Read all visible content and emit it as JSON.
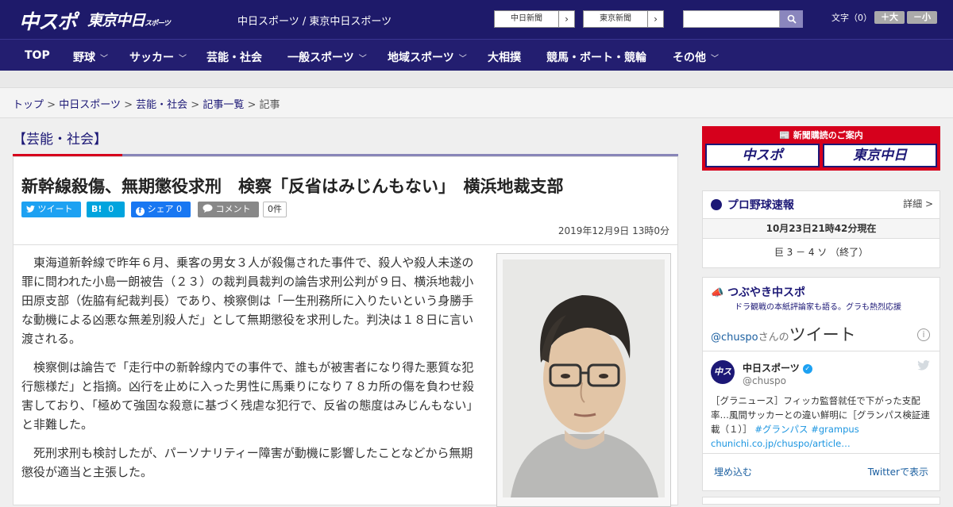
{
  "header": {
    "logo_main": "中スポ",
    "logo_tokyo": "東京中日",
    "logo_tokyo_small": "スポーツ",
    "site_names": "中日スポーツ / 東京中日スポーツ",
    "link_chunichi": "中日新聞",
    "link_tokyo": "東京新聞",
    "font_label": "文字（0）",
    "font_bigger": "＋大",
    "font_smaller": "－小"
  },
  "nav": {
    "items": [
      {
        "label": "TOP",
        "has_menu": false
      },
      {
        "label": "野球",
        "has_menu": true
      },
      {
        "label": "サッカー",
        "has_menu": true
      },
      {
        "label": "芸能・社会",
        "has_menu": false
      },
      {
        "label": "一般スポーツ",
        "has_menu": true
      },
      {
        "label": "地域スポーツ",
        "has_menu": true
      },
      {
        "label": "大相撲",
        "has_menu": false
      },
      {
        "label": "競馬・ボート・競輪",
        "has_menu": false
      },
      {
        "label": "その他",
        "has_menu": true
      }
    ]
  },
  "breadcrumb": {
    "items": [
      "トップ",
      "中日スポーツ",
      "芸能・社会",
      "記事一覧"
    ],
    "current": "記事",
    "sep": ">"
  },
  "category": "【芸能・社会】",
  "article": {
    "headline": "新幹線殺傷、無期懲役求刑　検察「反省はみじんもない」　横浜地裁支部",
    "share": {
      "tweet": "ツイート",
      "hatena": "B!",
      "hatena_count": "0",
      "facebook": "シェア",
      "facebook_count": "0",
      "comment": "コメント",
      "comment_count": "0件"
    },
    "date": "2019年12月9日 13時0分",
    "paragraphs": [
      "東海道新幹線で昨年６月、乗客の男女３人が殺傷された事件で、殺人や殺人未遂の罪に問われた小島一朗被告（２３）の裁判員裁判の論告求刑公判が９日、横浜地裁小田原支部（佐脇有紀裁判長）であり、検察側は「一生刑務所に入りたいという身勝手な動機による凶悪な無差別殺人だ」として無期懲役を求刑した。判決は１８日に言い渡される。",
      "検察側は論告で「走行中の新幹線内での事件で、誰もが被害者になり得た悪質な犯行態様だ」と指摘。凶行を止めに入った男性に馬乗りになり７８カ所の傷を負わせ殺害しており、「極めて強固な殺意に基づく残虐な犯行で、反省の態度はみじんもない」と非難した。",
      "死刑求刑も検討したが、パーソナリティー障害が動機に影響したことなどから無期懲役が適当と主張した。"
    ]
  },
  "sidebar": {
    "ad": {
      "top": "新聞購読のご案内",
      "left": "中スポ",
      "right": "東京中日"
    },
    "baseball": {
      "title": "プロ野球速報",
      "more": "詳細 >",
      "time": "10月23日21時42分現在",
      "score": "巨 3 － 4 ソ （終了）"
    },
    "twitter": {
      "title": "つぶやき中スポ",
      "subtitle": "ドラ観戦の本紙評論家も語る。グラも熱烈応援",
      "handle_link": "@chuspo",
      "san": "さんの",
      "tweets_word": "ツイート",
      "account_name": "中日スポーツ",
      "account_handle": "@chuspo",
      "text_main": "［グラニュース］フィッカ監督就任で下がった支配率…風間サッカーとの違い鮮明に［グランパス検証連載（１）］",
      "hashtags": "#グランパス #grampus",
      "link": "chunichi.co.jp/chuspo/article…",
      "embed": "埋め込む",
      "view": "Twitterで表示"
    }
  },
  "colors": {
    "header_bg": "#1e1a6a",
    "accent_red": "#d6001c",
    "link_navy": "#1c1876",
    "twitter_blue": "#1da1f2"
  }
}
